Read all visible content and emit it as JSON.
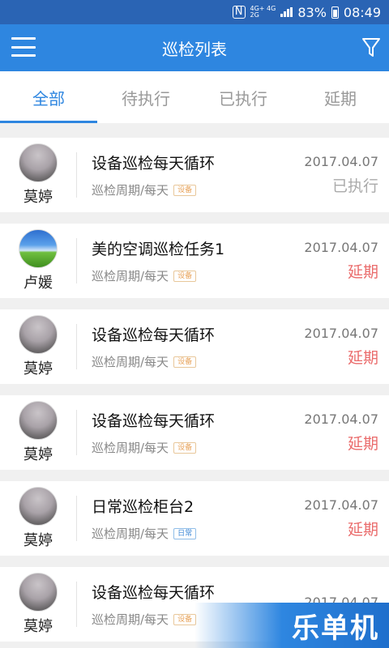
{
  "status_bar": {
    "battery": "83%",
    "time": "08:49",
    "net_top": "4G+ 4G",
    "net_bottom": "2G",
    "nfc": "N"
  },
  "appbar": {
    "title": "巡检列表"
  },
  "tabs": [
    {
      "label": "全部",
      "active": true
    },
    {
      "label": "待执行",
      "active": false
    },
    {
      "label": "已执行",
      "active": false
    },
    {
      "label": "延期",
      "active": false
    }
  ],
  "items": [
    {
      "author": "莫婷",
      "title": "设备巡检每天循环",
      "period": "巡检周期/每天",
      "tag": "设备",
      "date": "2017.04.07",
      "status": "已执行"
    },
    {
      "author": "卢媛",
      "title": "美的空调巡检任务1",
      "period": "巡检周期/每天",
      "tag": "设备",
      "date": "2017.04.07",
      "status": "延期"
    },
    {
      "author": "莫婷",
      "title": "设备巡检每天循环",
      "period": "巡检周期/每天",
      "tag": "设备",
      "date": "2017.04.07",
      "status": "延期"
    },
    {
      "author": "莫婷",
      "title": "设备巡检每天循环",
      "period": "巡检周期/每天",
      "tag": "设备",
      "date": "2017.04.07",
      "status": "延期"
    },
    {
      "author": "莫婷",
      "title": "日常巡检柜台2",
      "period": "巡检周期/每天",
      "tag": "日常",
      "date": "2017.04.07",
      "status": "延期"
    },
    {
      "author": "莫婷",
      "title": "设备巡检每天循环",
      "period": "巡检周期/每天",
      "tag": "设备",
      "date": "2017.04.07",
      "status": ""
    }
  ],
  "watermark": "乐单机",
  "colors": {
    "primary": "#2e86e0",
    "statusbar": "#2a64b4",
    "delay": "#ea6b6b",
    "done": "#aaaaaa"
  }
}
